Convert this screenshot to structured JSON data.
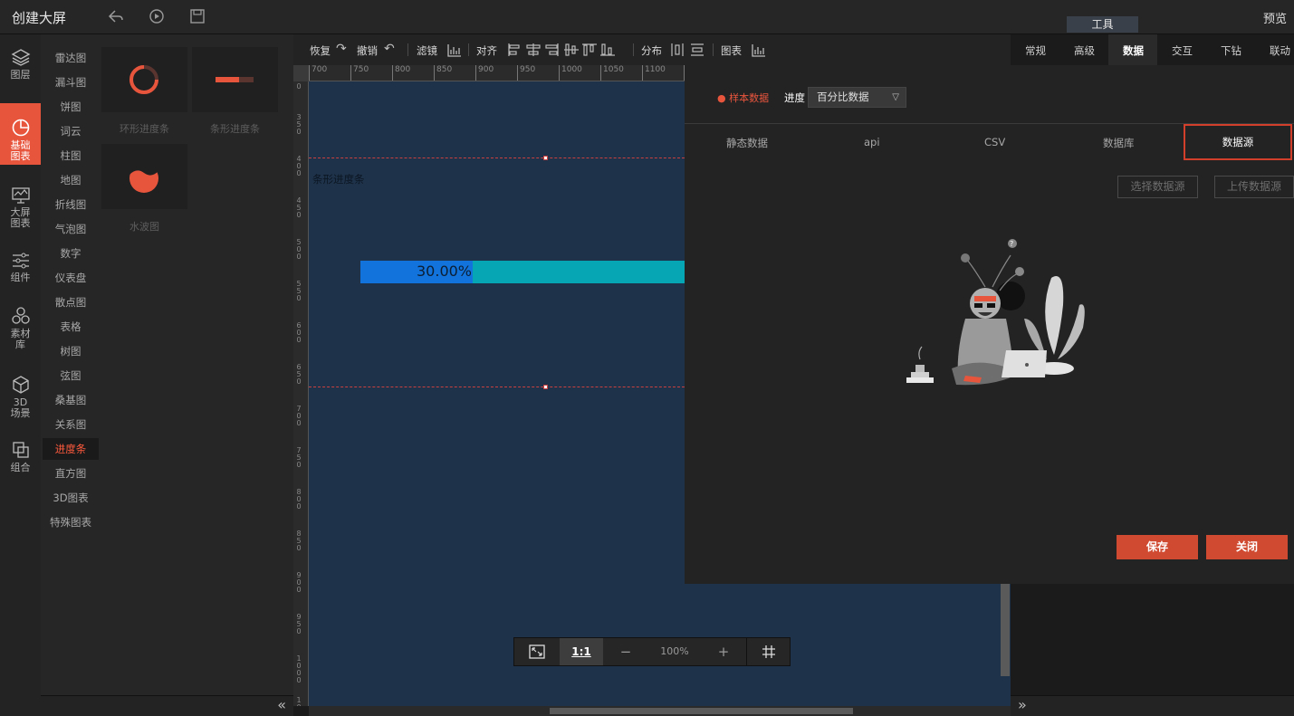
{
  "app": {
    "title": "创建大屏",
    "preview": "预览",
    "tool_tab": "工具"
  },
  "left_nav": [
    {
      "label": "图层",
      "icon": "layers-icon"
    },
    {
      "label": "基础图表",
      "icon": "pie-chart-icon",
      "active": true
    },
    {
      "label": "大屏图表",
      "icon": "monitor-chart-icon"
    },
    {
      "label": "组件",
      "icon": "sliders-icon"
    },
    {
      "label": "素材库",
      "icon": "hexagons-icon"
    },
    {
      "label": "3D场景",
      "icon": "cube-icon"
    },
    {
      "label": "组合",
      "icon": "combine-icon"
    }
  ],
  "sub_list": [
    "雷达图",
    "漏斗图",
    "饼图",
    "词云",
    "柱图",
    "地图",
    "折线图",
    "气泡图",
    "数字",
    "仪表盘",
    "散点图",
    "表格",
    "树图",
    "弦图",
    "桑基图",
    "关系图",
    "进度条",
    "直方图",
    "3D图表",
    "特殊图表"
  ],
  "sub_active_index": 16,
  "thumbs": [
    {
      "label": "环形进度条",
      "icon": "ring-progress-icon"
    },
    {
      "label": "条形进度条",
      "icon": "bar-progress-icon"
    },
    {
      "label": "水波图",
      "icon": "liquid-fill-icon"
    }
  ],
  "toolbar": {
    "redo": "恢复",
    "undo": "撤销",
    "filter": "滤镜",
    "align": "对齐",
    "distribute": "分布",
    "chart": "图表"
  },
  "ruler_top": [
    "700",
    "750",
    "800",
    "850",
    "900",
    "950",
    "1000",
    "1050",
    "1100",
    "11"
  ],
  "ruler_left": [
    "0",
    "3 5 0",
    "4 0 0",
    "4 5 0",
    "5 0 0",
    "5 5 0",
    "6 0 0",
    "6 5 0",
    "7 0 0",
    "7 5 0",
    "8 0 0",
    "8 5 0",
    "9 0 0",
    "9 5 0",
    "1 0 0 0",
    "1 0 5 0"
  ],
  "canvas": {
    "component_label": "条形进度条",
    "progress_text": "30.00%",
    "progress_value": 0.3431,
    "bar_bg_color": "#07a6b5",
    "bar_fill_color": "#1173db"
  },
  "zoombar": {
    "fit": "fit-screen-icon",
    "one_to_one": "1:1",
    "minus": "−",
    "zoom": "100%",
    "plus": "+",
    "grid": "grid-icon"
  },
  "right_tabs": [
    "常规",
    "高级",
    "数据",
    "交互",
    "下钻",
    "联动"
  ],
  "right_active_tab": 2,
  "modal": {
    "sample_label": "样本数据",
    "progress_label": "进度",
    "select_value": "百分比数据",
    "tabs": [
      "静态数据",
      "api",
      "CSV",
      "数据库",
      "数据源"
    ],
    "active_tab": "数据源",
    "choose_btn": "选择数据源",
    "upload_btn": "上传数据源",
    "save_btn": "保存",
    "close_btn": "关闭",
    "accent": "#cf4a30"
  }
}
